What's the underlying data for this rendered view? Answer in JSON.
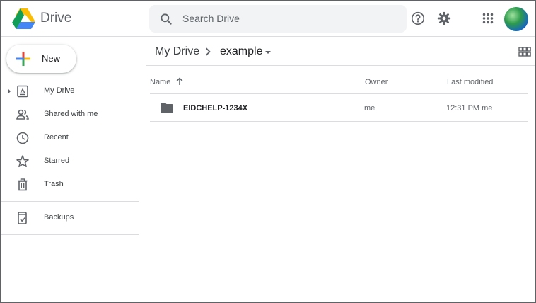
{
  "header": {
    "brand": "Drive",
    "search_placeholder": "Search Drive",
    "icons": [
      "drive-logo",
      "search-icon",
      "help-icon",
      "settings-icon",
      "apps-icon",
      "avatar"
    ]
  },
  "sidebar": {
    "new_label": "New",
    "items": [
      {
        "label": "My Drive",
        "icon": "my-drive-icon"
      },
      {
        "label": "Shared with me",
        "icon": "shared-icon"
      },
      {
        "label": "Recent",
        "icon": "clock-icon"
      },
      {
        "label": "Starred",
        "icon": "star-icon"
      },
      {
        "label": "Trash",
        "icon": "trash-icon"
      },
      {
        "label": "Backups",
        "icon": "backups-icon"
      }
    ]
  },
  "main": {
    "breadcrumb": {
      "root": "My Drive",
      "current": "example"
    },
    "columns": {
      "name": "Name",
      "owner": "Owner",
      "modified": "Last modified"
    },
    "rows": [
      {
        "name": "EIDCHELP-1234X",
        "owner": "me",
        "modified": "12:31 PM me",
        "type": "folder"
      }
    ]
  },
  "colors": {
    "accent_blue": "#1a73e8",
    "google_blue": "#4285f4",
    "google_red": "#ea4335",
    "google_yellow": "#fbbc04",
    "google_green": "#34a853",
    "divider": "#dadce0",
    "search_bg": "#f1f3f4"
  }
}
